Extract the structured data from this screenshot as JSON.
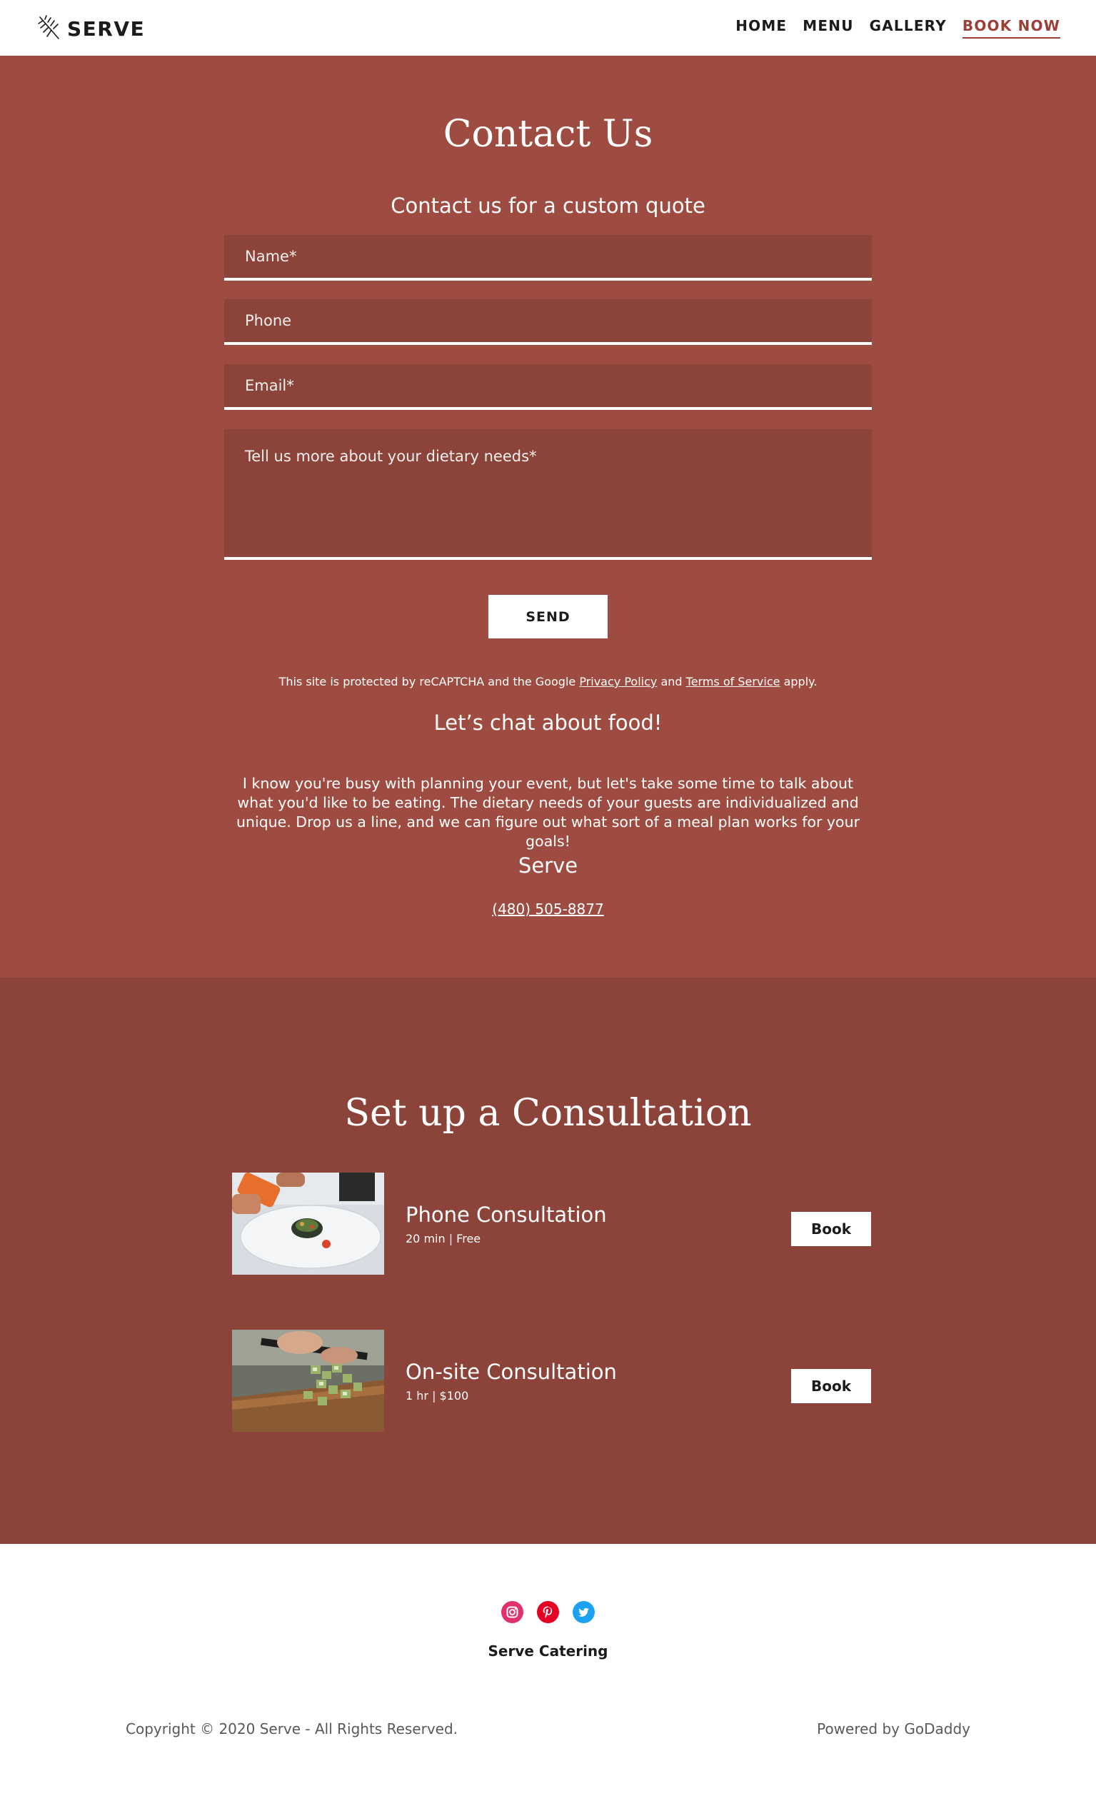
{
  "header": {
    "logo_text": "SERVE",
    "nav": [
      "HOME",
      "MENU",
      "GALLERY",
      "BOOK NOW"
    ],
    "active_nav": "BOOK NOW"
  },
  "contact": {
    "title": "Contact Us",
    "subtitle": "Contact us for a custom quote",
    "fields": {
      "name_placeholder": "Name*",
      "phone_placeholder": "Phone",
      "email_placeholder": "Email*",
      "message_placeholder": "Tell us more about your dietary needs*"
    },
    "send_label": "SEND",
    "recaptcha": {
      "prefix": "This site is protected by reCAPTCHA and the Google ",
      "privacy_link": "Privacy Policy",
      "middle": " and ",
      "terms_link": "Terms of Service",
      "suffix": " apply."
    },
    "chat_title": "Let’s chat about food!",
    "chat_body": "I know you're busy with planning your event, but let's take some time to talk about what you'd like to be eating. The dietary needs of your guests are individualized and unique. Drop us a line, and we can figure out what sort of a meal plan works for your goals!",
    "business_name": "Serve",
    "phone": "(480) 505-8877"
  },
  "consultation": {
    "title": "Set up a Consultation",
    "services": [
      {
        "name": "Phone Consultation",
        "meta": "20 min | Free",
        "book_label": "Book"
      },
      {
        "name": "On-site Consultation",
        "meta": "1 hr | $100",
        "book_label": "Book"
      }
    ]
  },
  "footer": {
    "social": [
      "instagram-icon",
      "pinterest-icon",
      "twitter-icon"
    ],
    "business_name": "Serve Catering",
    "copyright": "Copyright © 2020 Serve - All Rights Reserved.",
    "powered_by": "Powered by GoDaddy"
  },
  "colors": {
    "brand_red": "#9e4c41",
    "dark_red": "#8b433a",
    "nav_active": "#9b3f37",
    "instagram": "#e1306c",
    "pinterest": "#e60023",
    "twitter": "#1da1f2"
  }
}
